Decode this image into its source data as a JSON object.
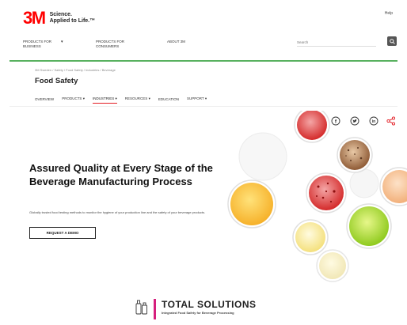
{
  "brand": {
    "logo_text": "3M",
    "tagline_line1": "Science.",
    "tagline_line2": "Applied to Life.™",
    "help": "Help"
  },
  "topnav": {
    "business_line1": "PRODUCTS FOR",
    "business_line2": "BUSINESS",
    "consumers_line1": "PRODUCTS FOR",
    "consumers_line2": "CONSUMERS",
    "about": "ABOUT 3M",
    "search_placeholder": "Search"
  },
  "breadcrumb": "3M Sweden / Safety / Food Safety / Industries / Beverage",
  "page_title": "Food Safety",
  "subnav": {
    "items": [
      {
        "label": "Overview",
        "active": false
      },
      {
        "label": "Products",
        "active": false
      },
      {
        "label": "Industries",
        "active": true
      },
      {
        "label": "Resources",
        "active": false
      },
      {
        "label": "Education",
        "active": false
      },
      {
        "label": "Support",
        "active": false
      }
    ]
  },
  "share_icons": [
    "email-icon",
    "facebook-icon",
    "twitter-icon",
    "linkedin-icon",
    "share-icon"
  ],
  "hero": {
    "title": "Assured Quality at Every Stage of the Beverage Manufacturing Process",
    "description": "Globally trusted food testing methods to monitor the hygiene of your production line and the safety of your beverage products.",
    "cta": "REQUEST A DEMO"
  },
  "bottom": {
    "heading": "TOTAL SOLUTIONS",
    "subheading": "Integrated Food Safety for Beverage Processing"
  },
  "colors": {
    "brand_red": "#ff0000",
    "accent_green": "#58b15f",
    "active_underline": "#e31c23",
    "magenta": "#d61f7d"
  }
}
